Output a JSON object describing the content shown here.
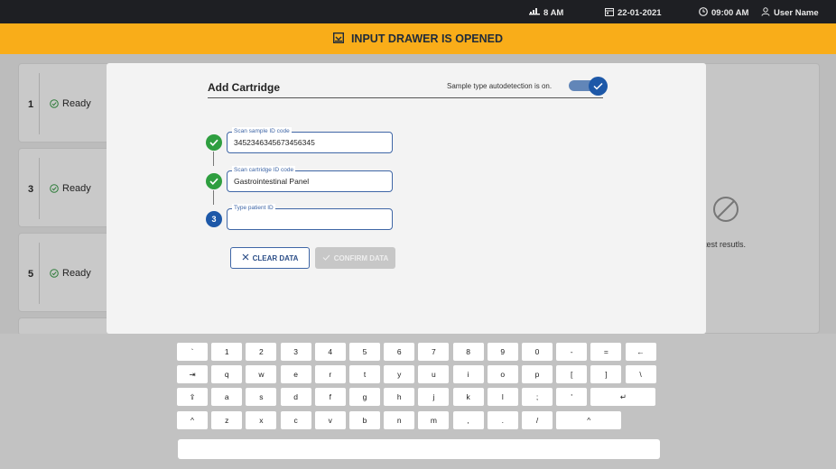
{
  "topbar": {
    "signal": "8 AM",
    "date": "22-01-2021",
    "time": "09:00 AM",
    "user": "User Name"
  },
  "banner": {
    "text": "INPUT DRAWER IS OPENED"
  },
  "slots": [
    {
      "num": "1",
      "status": "Ready"
    },
    {
      "num": "3",
      "status": "Ready"
    },
    {
      "num": "5",
      "status": "Ready"
    }
  ],
  "right_panel": {
    "text": "atest resutls."
  },
  "dialog": {
    "title": "Add Cartridge",
    "autodetect": "Sample type autodetection is on.",
    "toggle_on": true,
    "fields": [
      {
        "label": "Scan sample ID code",
        "value": "3452346345673456345",
        "step": "done"
      },
      {
        "label": "Scan cartridge ID code",
        "value": "Gastrointestinal Panel",
        "step": "done"
      },
      {
        "label": "Type patient ID",
        "value": "",
        "step": "3"
      }
    ],
    "clear_label": "CLEAR DATA",
    "confirm_label": "CONFIRM DATA"
  },
  "keyboard": {
    "rows": [
      [
        "`",
        "1",
        "2",
        "3",
        "4",
        "5",
        "6",
        "7",
        "8",
        "9",
        "0",
        "-",
        "=",
        "←"
      ],
      [
        "⇥",
        "q",
        "w",
        "e",
        "r",
        "t",
        "y",
        "u",
        "i",
        "o",
        "p",
        "[",
        "]",
        "\\"
      ],
      [
        "⇪",
        "a",
        "s",
        "d",
        "f",
        "g",
        "h",
        "j",
        "k",
        "l",
        ";",
        "'",
        "↵"
      ],
      [
        "^",
        "z",
        "x",
        "c",
        "v",
        "b",
        "n",
        "m",
        ",",
        ".",
        "/",
        "^"
      ]
    ]
  },
  "colors": {
    "accent": "#1d58a8",
    "banner": "#f9ad19",
    "success": "#2e9e3f"
  }
}
